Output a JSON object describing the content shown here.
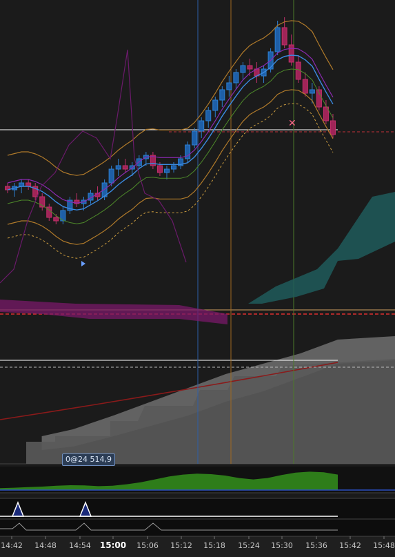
{
  "chart_data": {
    "type": "candlestick",
    "title": "",
    "xlabel": "",
    "ylabel": "",
    "x_ticks": [
      "14:42",
      "14:48",
      "14:54",
      "15:00",
      "15:06",
      "15:12",
      "15:18",
      "15:24",
      "15:30",
      "15:36",
      "15:42",
      "15:48"
    ],
    "x_ticks_bold": "15:00",
    "price_tag": "0@24 514,9",
    "grid": false,
    "legend": "none",
    "series": [
      {
        "type": "candles",
        "values": [
          [
            0.5,
            0.51,
            0.48,
            0.49
          ],
          [
            0.49,
            0.51,
            0.47,
            0.5
          ],
          [
            0.5,
            0.52,
            0.48,
            0.51
          ],
          [
            0.51,
            0.52,
            0.49,
            0.5
          ],
          [
            0.5,
            0.51,
            0.46,
            0.47
          ],
          [
            0.47,
            0.48,
            0.43,
            0.44
          ],
          [
            0.44,
            0.45,
            0.4,
            0.41
          ],
          [
            0.41,
            0.42,
            0.39,
            0.4
          ],
          [
            0.4,
            0.44,
            0.39,
            0.43
          ],
          [
            0.43,
            0.47,
            0.42,
            0.46
          ],
          [
            0.46,
            0.48,
            0.44,
            0.45
          ],
          [
            0.45,
            0.47,
            0.43,
            0.46
          ],
          [
            0.46,
            0.49,
            0.45,
            0.48
          ],
          [
            0.48,
            0.5,
            0.46,
            0.47
          ],
          [
            0.47,
            0.52,
            0.46,
            0.51
          ],
          [
            0.51,
            0.56,
            0.5,
            0.55
          ],
          [
            0.55,
            0.58,
            0.53,
            0.56
          ],
          [
            0.56,
            0.58,
            0.54,
            0.55
          ],
          [
            0.55,
            0.57,
            0.53,
            0.56
          ],
          [
            0.56,
            0.59,
            0.55,
            0.58
          ],
          [
            0.58,
            0.6,
            0.56,
            0.59
          ],
          [
            0.59,
            0.6,
            0.55,
            0.56
          ],
          [
            0.56,
            0.57,
            0.53,
            0.54
          ],
          [
            0.54,
            0.56,
            0.52,
            0.55
          ],
          [
            0.55,
            0.57,
            0.54,
            0.56
          ],
          [
            0.56,
            0.59,
            0.55,
            0.58
          ],
          [
            0.58,
            0.63,
            0.57,
            0.62
          ],
          [
            0.62,
            0.67,
            0.61,
            0.66
          ],
          [
            0.66,
            0.7,
            0.64,
            0.69
          ],
          [
            0.69,
            0.73,
            0.67,
            0.72
          ],
          [
            0.72,
            0.76,
            0.7,
            0.75
          ],
          [
            0.75,
            0.79,
            0.73,
            0.78
          ],
          [
            0.78,
            0.82,
            0.76,
            0.8
          ],
          [
            0.8,
            0.84,
            0.78,
            0.83
          ],
          [
            0.83,
            0.86,
            0.81,
            0.85
          ],
          [
            0.85,
            0.87,
            0.82,
            0.84
          ],
          [
            0.84,
            0.86,
            0.8,
            0.82
          ],
          [
            0.82,
            0.85,
            0.8,
            0.84
          ],
          [
            0.84,
            0.9,
            0.83,
            0.89
          ],
          [
            0.89,
            0.98,
            0.88,
            0.96
          ],
          [
            0.96,
            0.99,
            0.9,
            0.91
          ],
          [
            0.91,
            0.94,
            0.85,
            0.86
          ],
          [
            0.86,
            0.88,
            0.8,
            0.81
          ],
          [
            0.81,
            0.83,
            0.76,
            0.77
          ],
          [
            0.77,
            0.8,
            0.74,
            0.78
          ],
          [
            0.78,
            0.79,
            0.72,
            0.73
          ],
          [
            0.73,
            0.75,
            0.68,
            0.69
          ],
          [
            0.69,
            0.71,
            0.64,
            0.65
          ]
        ]
      }
    ],
    "cloud_ranges": [
      {
        "t": 0.05,
        "low": 0.08,
        "high": 0.16
      },
      {
        "t": 0.15,
        "low": 0.1,
        "high": 0.2
      },
      {
        "t": 0.28,
        "low": 0.16,
        "high": 0.28
      },
      {
        "t": 0.4,
        "low": 0.22,
        "high": 0.36
      },
      {
        "t": 0.52,
        "low": 0.28,
        "high": 0.44
      },
      {
        "t": 0.64,
        "low": 0.36,
        "high": 0.52
      },
      {
        "t": 0.76,
        "low": 0.42,
        "high": 0.58
      },
      {
        "t": 0.88,
        "low": 0.5,
        "high": 0.64
      },
      {
        "t": 1.0,
        "low": 0.58,
        "high": 0.72
      }
    ],
    "oscillator": [
      0.1,
      0.12,
      0.15,
      0.18,
      0.22,
      0.25,
      0.24,
      0.2,
      0.22,
      0.3,
      0.4,
      0.55,
      0.7,
      0.8,
      0.85,
      0.82,
      0.75,
      0.62,
      0.55,
      0.62,
      0.78,
      0.9,
      0.95,
      0.92,
      0.8
    ],
    "markers": [
      0.05,
      0.26
    ]
  }
}
